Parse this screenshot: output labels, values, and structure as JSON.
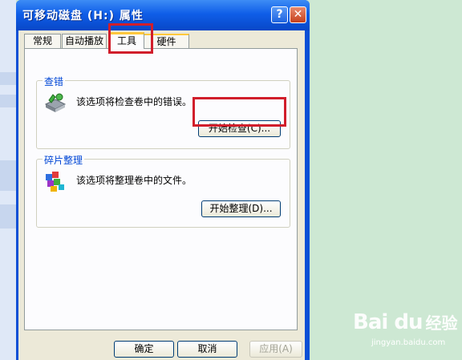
{
  "window": {
    "title": "可移动磁盘 (H:) 属性",
    "help_glyph": "?",
    "close_glyph": "✕"
  },
  "tabs": [
    {
      "label": "常规"
    },
    {
      "label": "自动播放"
    },
    {
      "label": "工具",
      "selected": true
    },
    {
      "label": "硬件"
    }
  ],
  "error_check": {
    "title": "查错",
    "description": "该选项将检查卷中的错误。",
    "button": "开始检查(C)...",
    "icon": "disk-check-icon"
  },
  "defrag": {
    "title": "碎片整理",
    "description": "该选项将整理卷中的文件。",
    "button": "开始整理(D)...",
    "icon": "defrag-icon"
  },
  "footer": {
    "ok": "确定",
    "cancel": "取消",
    "apply": "应用(A)"
  },
  "watermark": {
    "logo": "Bai du",
    "suffix": "经验",
    "url": "jingyan.baidu.com"
  },
  "colors": {
    "highlight": "#d11e2b",
    "titlebar": "#0f5ee8",
    "group_title": "#0046d5"
  }
}
